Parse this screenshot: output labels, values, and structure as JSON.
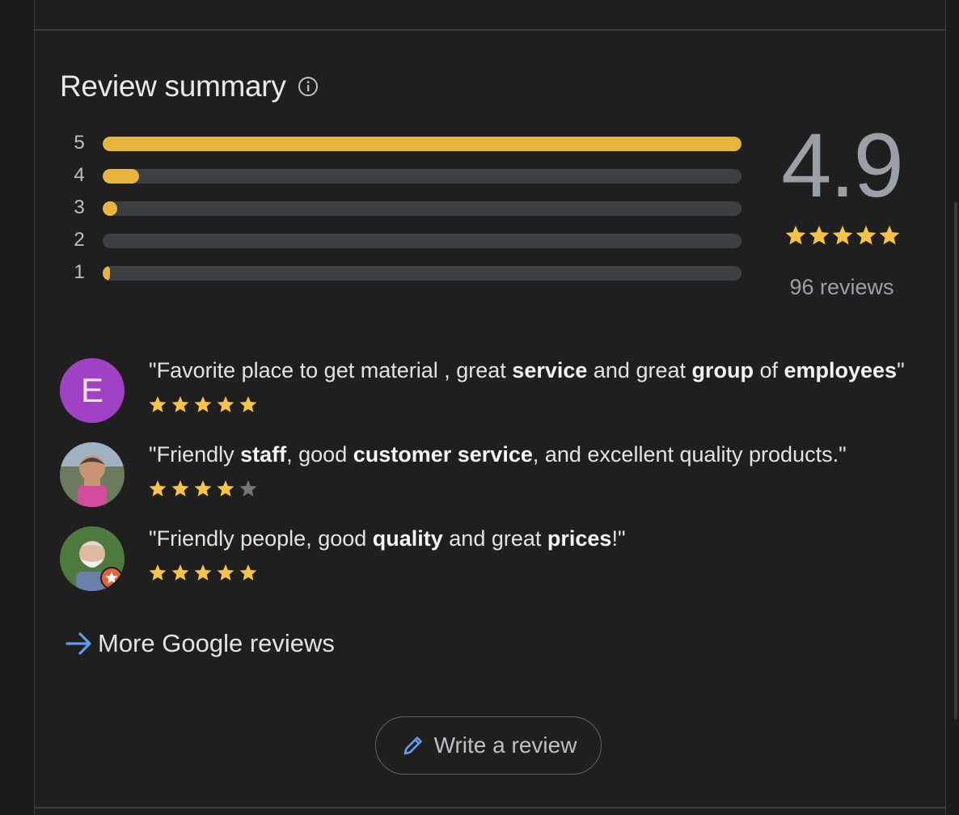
{
  "title": "Review summary",
  "histogram": [
    {
      "label": "5",
      "fraction": 1.0
    },
    {
      "label": "4",
      "fraction": 0.057
    },
    {
      "label": "3",
      "fraction": 0.023
    },
    {
      "label": "2",
      "fraction": 0.0
    },
    {
      "label": "1",
      "fraction": 0.011
    }
  ],
  "rating": "4.9",
  "rating_stars": 5,
  "review_count": "96 reviews",
  "reviews": [
    {
      "avatar_letter": "E",
      "avatar_color": "#a142c4",
      "stars": 5,
      "quote": [
        {
          "t": "\"Favorite place to get material , great ",
          "b": false
        },
        {
          "t": "service",
          "b": true
        },
        {
          "t": " and great ",
          "b": false
        },
        {
          "t": "group",
          "b": true
        },
        {
          "t": " of ",
          "b": false
        },
        {
          "t": "employees",
          "b": true
        },
        {
          "t": "\"",
          "b": false
        }
      ]
    },
    {
      "avatar_letter": "",
      "avatar_color": "",
      "stars": 4,
      "quote": [
        {
          "t": "\"Friendly ",
          "b": false
        },
        {
          "t": "staff",
          "b": true
        },
        {
          "t": ", good ",
          "b": false
        },
        {
          "t": "customer service",
          "b": true
        },
        {
          "t": ", and excellent quality products.\"",
          "b": false
        }
      ]
    },
    {
      "avatar_letter": "",
      "avatar_color": "",
      "stars": 5,
      "quote": [
        {
          "t": "\"Friendly people, good ",
          "b": false
        },
        {
          "t": "quality",
          "b": true
        },
        {
          "t": " and great ",
          "b": false
        },
        {
          "t": "prices",
          "b": true
        },
        {
          "t": "!\"",
          "b": false
        }
      ]
    }
  ],
  "more_link": "More Google reviews",
  "write_button": "Write a review",
  "colors": {
    "star": "#f6c344",
    "star_empty": "#707579",
    "bar_fill": "#e8b53d",
    "bar_track": "#3c4043",
    "link_arrow": "#5b9cf5",
    "pencil": "#6a99ee"
  },
  "icons": {
    "info": "info-icon",
    "arrow": "arrow-right-icon",
    "pencil": "pencil-icon",
    "star": "star-icon"
  }
}
